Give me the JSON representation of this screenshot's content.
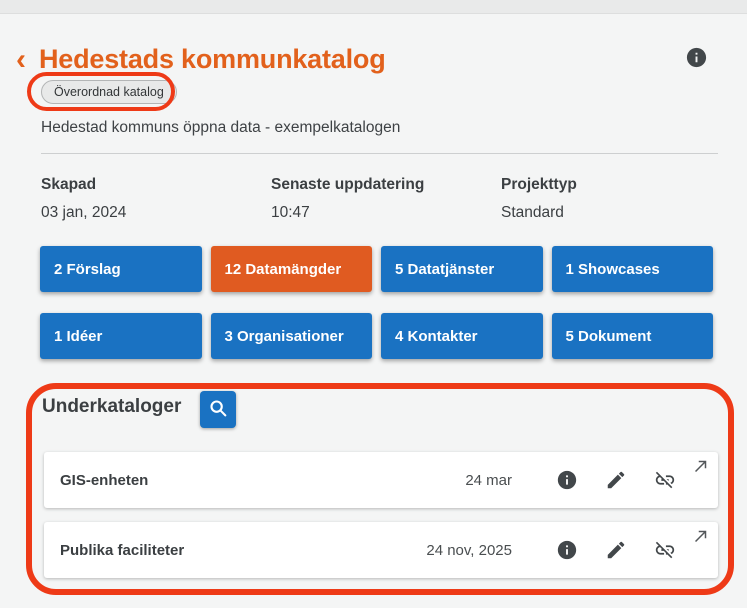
{
  "header": {
    "back": "‹",
    "title": "Hedestads kommunkatalog",
    "badge": "Överordnad katalog",
    "description": "Hedestad kommuns öppna data - exempelkatalogen"
  },
  "meta": {
    "columns": [
      {
        "label": "Skapad",
        "value": "03 jan, 2024"
      },
      {
        "label": "Senaste uppdatering",
        "value": "10:47"
      },
      {
        "label": "Projekttyp",
        "value": "Standard"
      }
    ]
  },
  "counters": [
    {
      "label": "2 Förslag",
      "active": false
    },
    {
      "label": "12 Datamängder",
      "active": true
    },
    {
      "label": "5 Datatjänster",
      "active": false
    },
    {
      "label": "1 Showcases",
      "active": false
    },
    {
      "label": "1 Idéer",
      "active": false
    },
    {
      "label": "3 Organisationer",
      "active": false
    },
    {
      "label": "4 Kontakter",
      "active": false
    },
    {
      "label": "5 Dokument",
      "active": false
    }
  ],
  "subcatalogs": {
    "heading": "Underkataloger",
    "items": [
      {
        "name": "GIS-enheten",
        "date": "24 mar"
      },
      {
        "name": "Publika faciliteter",
        "date": "24 nov, 2025"
      }
    ]
  },
  "icons": {
    "header_info": "info-circle",
    "search": "magnifier",
    "row_icons": [
      "info-circle",
      "edit-pencil",
      "link-off",
      "open-external-arrow"
    ]
  },
  "annotations": {
    "badge_highlight": "red oval drawn around Överordnad katalog badge",
    "section_highlight": "red rounded box drawn around Underkataloger section"
  },
  "colors": {
    "title_orange": "#e2611c",
    "button_blue": "#1a72c2",
    "active_orange": "#e05b21",
    "annotation_red": "#ee3a17"
  }
}
